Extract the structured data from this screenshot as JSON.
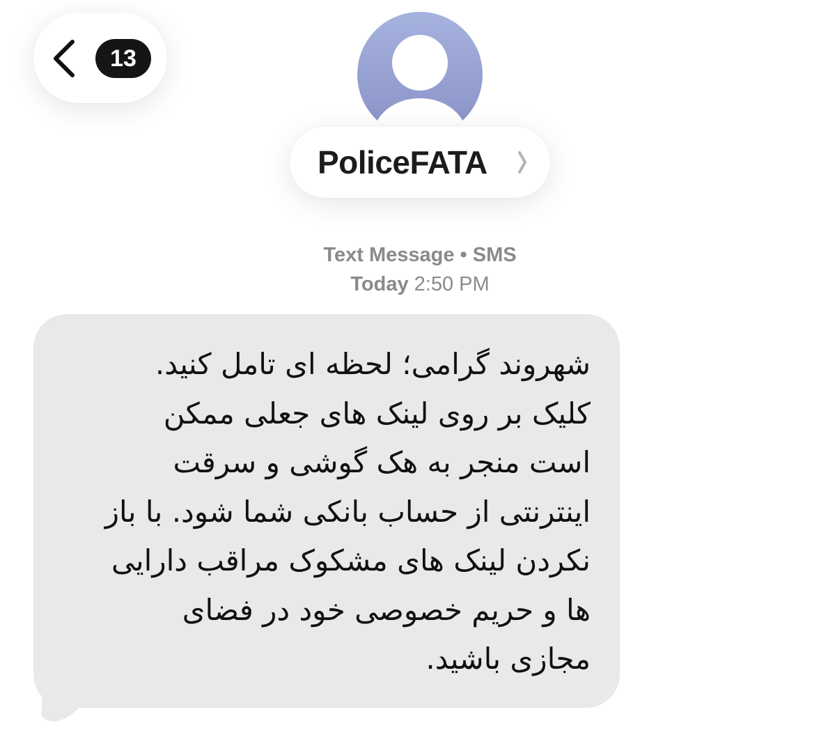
{
  "nav": {
    "unread_count": "13",
    "back_icon": "chevron-left-icon"
  },
  "contact": {
    "name": "PoliceFATA",
    "avatar_icon": "person-silhouette-icon",
    "details_icon": "chevron-right-icon"
  },
  "thread": {
    "message_type": "Text Message • SMS",
    "day": "Today",
    "time": "2:50 PM"
  },
  "message": {
    "text": "شهروند گرامی؛ لحظه ای تامل کنید.\nکلیک بر روی لینک های جعلی ممکن\nاست منجر به هک گوشی و سرقت\nاینترنتی از حساب بانکی شما شود. با باز\nنکردن لینک های مشکوک مراقب دارایی\nها و حریم خصوصی خود در فضای\nمجازی باشید."
  },
  "colors": {
    "bubble": "#e9e9eb",
    "badge": "#151515",
    "avatar_top": "#a6b2de",
    "avatar_bottom": "#8891c6",
    "meta_text": "#8a8a8e"
  }
}
